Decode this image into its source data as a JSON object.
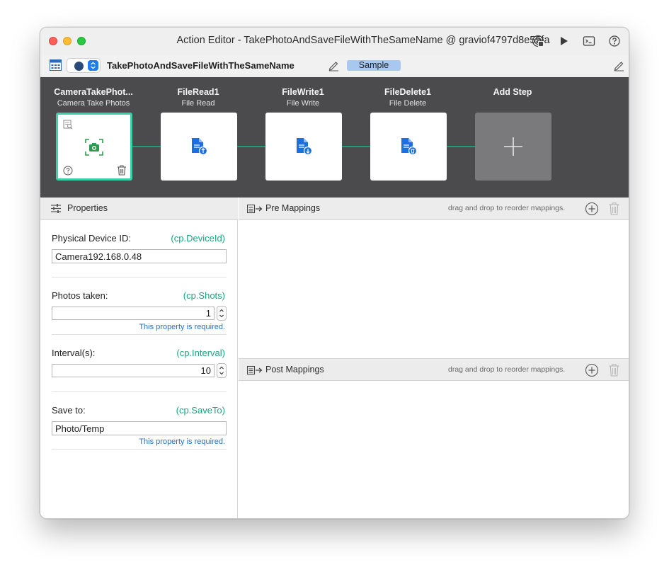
{
  "window": {
    "title": "Action Editor - TakePhotoAndSaveFileWithTheSameName @ graviof4797d8e55fa",
    "icons": [
      "broadcast-icon",
      "play-icon",
      "terminal-icon",
      "help-icon"
    ]
  },
  "toolbar": {
    "action_name": "TakePhotoAndSaveFileWithTheSameName",
    "badge": "Sample"
  },
  "steps": [
    {
      "title": "CameraTakePhot...",
      "subtitle": "Camera Take Photos",
      "icon": "camera-icon",
      "active": true
    },
    {
      "title": "FileRead1",
      "subtitle": "File Read",
      "icon": "file-read-icon"
    },
    {
      "title": "FileWrite1",
      "subtitle": "File Write",
      "icon": "file-write-icon"
    },
    {
      "title": "FileDelete1",
      "subtitle": "File Delete",
      "icon": "file-delete-icon"
    },
    {
      "title": "Add Step",
      "subtitle": "",
      "icon": "plus-icon"
    }
  ],
  "properties": {
    "header": "Properties",
    "fields": [
      {
        "label": "Physical Device ID:",
        "key": "(cp.DeviceId)",
        "value": "Camera192.168.0.48",
        "required_note": ""
      },
      {
        "label": "Photos taken:",
        "key": "(cp.Shots)",
        "value": "1",
        "required_note": "This property is required."
      },
      {
        "label": "Interval(s):",
        "key": "(cp.Interval)",
        "value": "10",
        "required_note": ""
      },
      {
        "label": "Save to:",
        "key": "(cp.SaveTo)",
        "value": "Photo/Temp",
        "required_note": "This property is required."
      }
    ]
  },
  "pre_mappings": {
    "header": "Pre Mappings",
    "hint": "drag and drop to reorder mappings."
  },
  "post_mappings": {
    "header": "Post Mappings",
    "hint": "drag and drop to reorder mappings."
  },
  "colors": {
    "accent_green": "#3bd1a6",
    "key_green": "#1aa57f",
    "link_blue": "#1b6fd8",
    "steps_bg": "#4b4b4e",
    "badge_blue": "#a9c8f0"
  }
}
